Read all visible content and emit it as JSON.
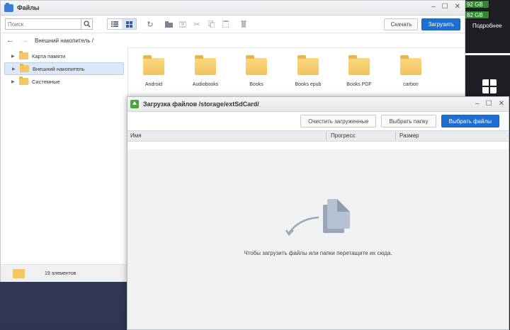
{
  "desktop": {
    "storage_badges": [
      "92 GB",
      "82 GB"
    ],
    "more_label": "Подробнее"
  },
  "files_window": {
    "title": "Файлы",
    "search_placeholder": "Поиск",
    "buttons": {
      "cancel": "Скачать",
      "upload": "Загрузить"
    },
    "breadcrumb": "Внешний накопитель /",
    "sidebar": [
      {
        "label": "Карта памяти",
        "selected": false
      },
      {
        "label": "Внешний накопитель",
        "selected": true
      },
      {
        "label": "Системные",
        "selected": false
      }
    ],
    "folders": [
      "Android",
      "Audiobooks",
      "Books",
      "Books epub",
      "Books PDF",
      "carbon"
    ],
    "status": "19 элементов"
  },
  "upload_dialog": {
    "title": "Загрузка файлов /storage/extSdCard/",
    "buttons": {
      "clear": "Очистить загруженные",
      "choose_folder": "Выбрать папку",
      "choose_files": "Выбрать файлы"
    },
    "columns": {
      "name": "Имя",
      "progress": "Прогресс",
      "size": "Размер"
    },
    "drop_hint": "Чтобы загрузить файлы или папки перетащите их сюда."
  },
  "colors": {
    "accent": "#1f6fd0",
    "folder": "#f3c661",
    "storage_badge": "#2f8a2f"
  }
}
